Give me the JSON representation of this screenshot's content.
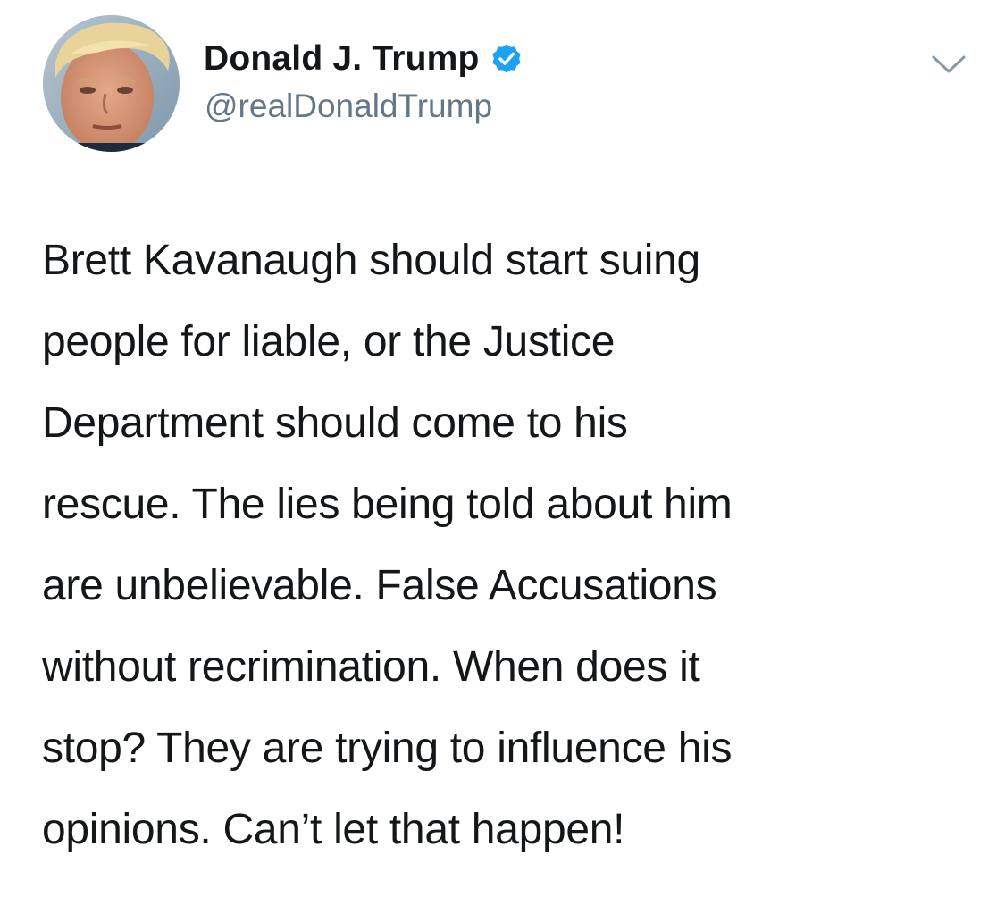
{
  "user": {
    "display_name": "Donald J. Trump",
    "handle": "@realDonaldTrump",
    "verified": true,
    "avatar_icon": "profile-photo"
  },
  "tweet": {
    "lines": [
      "Brett Kavanaugh should start suing",
      "people for liable, or the Justice",
      "Department should come to his",
      "rescue. The lies being told about him",
      "are unbelievable. False Accusations",
      "without recrimination. When does it",
      "stop? They are trying to influence his",
      "opinions. Can’t let that happen!"
    ]
  },
  "menu": {
    "icon": "chevron-down-icon"
  },
  "colors": {
    "name": "#14171a",
    "handle": "#657786",
    "verified": "#1da1f2",
    "caret": "#8899a6",
    "text": "#14171a"
  }
}
